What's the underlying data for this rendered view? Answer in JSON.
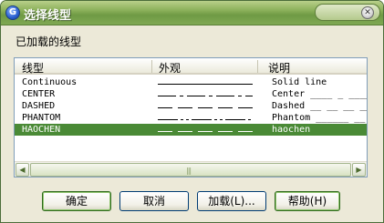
{
  "window": {
    "title": "选择线型",
    "app_icon_glyph": "G"
  },
  "loaded_label": "已加载的线型",
  "columns": {
    "linetype": "线型",
    "appearance": "外观",
    "description": "说明"
  },
  "rows": [
    {
      "name": "Continuous",
      "description": "Solid line",
      "pattern": "continuous",
      "selected": false
    },
    {
      "name": "CENTER",
      "description": "Center ____ _ ____",
      "pattern": "center",
      "selected": false
    },
    {
      "name": "DASHED",
      "description": "Dashed __ __ __ __",
      "pattern": "dashed",
      "selected": false
    },
    {
      "name": "PHANTOM",
      "description": "Phantom ______ __",
      "pattern": "phantom",
      "selected": false
    },
    {
      "name": "HAOCHEN",
      "description": "haochen",
      "pattern": "dashed",
      "selected": true
    }
  ],
  "buttons": {
    "ok": "确定",
    "cancel": "取消",
    "load": "加载(L)...",
    "help": "帮助(H)"
  },
  "colors": {
    "title_bar": "#7fa853",
    "selection": "#4a8a36"
  }
}
